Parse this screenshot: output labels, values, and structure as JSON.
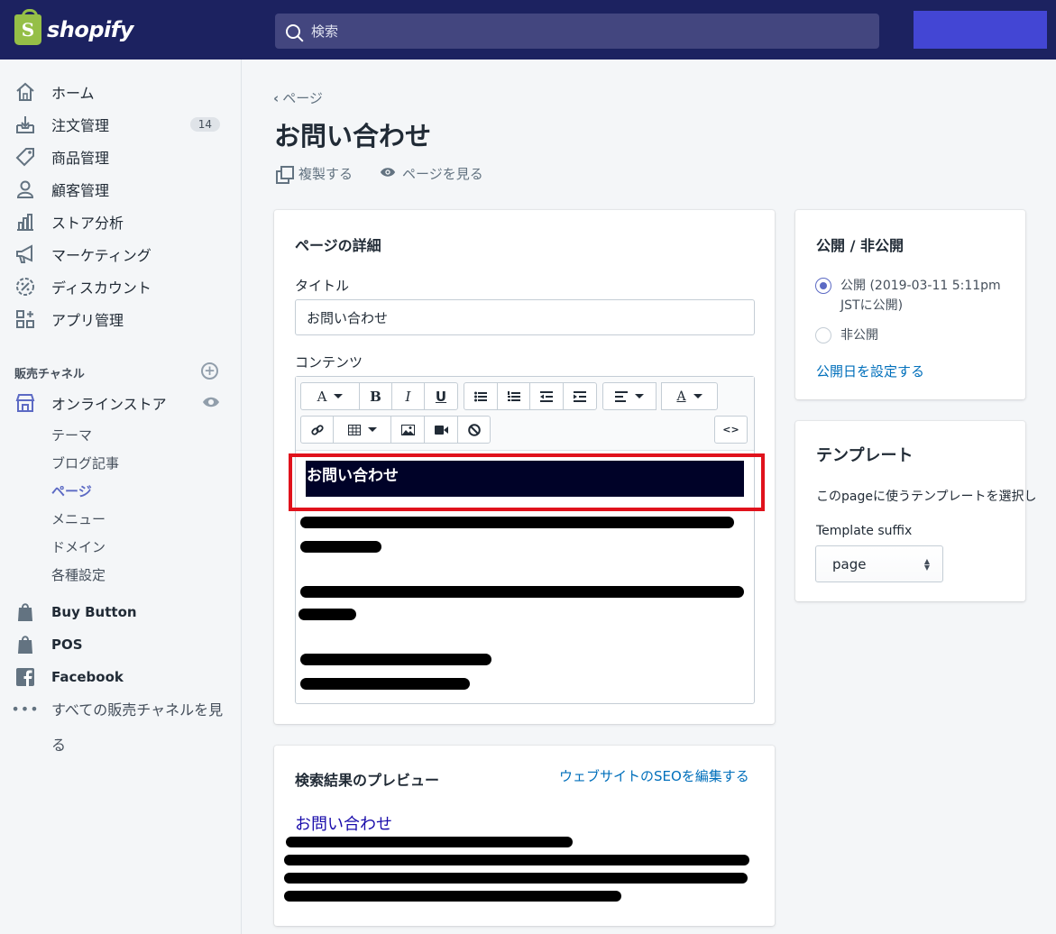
{
  "topbar": {
    "logo_text": "shopify",
    "logo_glyph": "S",
    "search_placeholder": "検索"
  },
  "sidebar": {
    "items": [
      {
        "label": "ホーム",
        "icon": "home-icon"
      },
      {
        "label": "注文管理",
        "icon": "orders-icon",
        "badge": "14"
      },
      {
        "label": "商品管理",
        "icon": "tag-icon"
      },
      {
        "label": "顧客管理",
        "icon": "person-icon"
      },
      {
        "label": "ストア分析",
        "icon": "analytics-icon"
      },
      {
        "label": "マーケティング",
        "icon": "megaphone-icon"
      },
      {
        "label": "ディスカウント",
        "icon": "discount-icon"
      },
      {
        "label": "アプリ管理",
        "icon": "apps-icon"
      }
    ],
    "channels_title": "販売チャネル",
    "online_store": "オンラインストア",
    "sub_items": [
      "テーマ",
      "ブログ記事",
      "ページ",
      "メニュー",
      "ドメイン",
      "各種設定"
    ],
    "buy_button": "Buy Button",
    "pos": "POS",
    "facebook": "Facebook",
    "all_channels_1": "すべての販売チャネルを見",
    "all_channels_2": "る"
  },
  "page": {
    "breadcrumb": "ページ",
    "title": "お問い合わせ",
    "duplicate": "複製する",
    "view_page": "ページを見る"
  },
  "details": {
    "title": "ページの詳細",
    "title_label": "タイトル",
    "title_value": "お問い合わせ",
    "content_label": "コンテンツ",
    "toolbar": {
      "font": "A",
      "bold": "B",
      "italic": "I",
      "underline": "U",
      "color": "A",
      "html": "<>"
    },
    "heading_text": "お問い合わせ"
  },
  "seo": {
    "title": "検索結果のプレビュー",
    "edit_link": "ウェブサイトのSEOを編集する",
    "preview_title": "お問い合わせ"
  },
  "visibility": {
    "title": "公開 / 非公開",
    "published_1": "公開 (2019-03-11 5:11pm",
    "published_2": "JSTに公開)",
    "hidden": "非公開",
    "set_date": "公開日を設定する"
  },
  "template": {
    "title": "テンプレート",
    "description": "このpageに使うテンプレートを選択し",
    "suffix_label": "Template suffix",
    "suffix_value": "page"
  },
  "colors": {
    "topbar": "#1c2260",
    "accent": "#5c6ac4",
    "link": "#006fbb",
    "highlight_box": "#e0121c"
  }
}
